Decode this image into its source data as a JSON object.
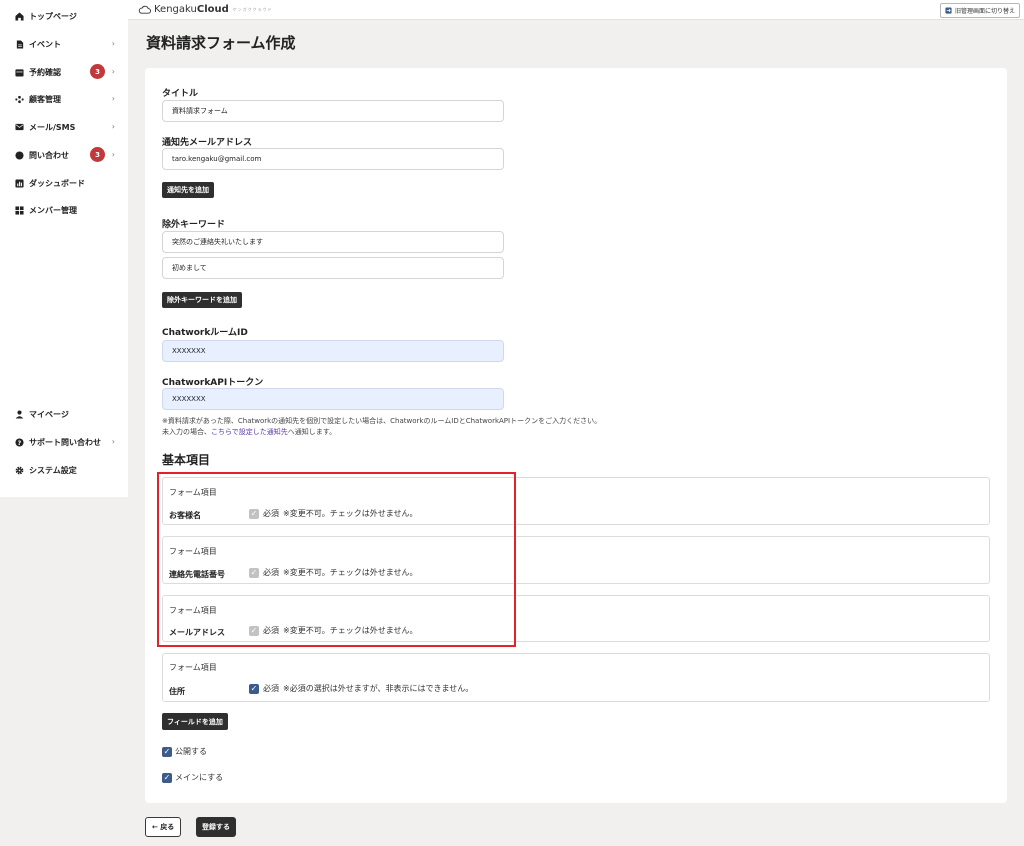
{
  "sidebar": {
    "items": [
      {
        "label": "トップページ",
        "icon": "home-icon"
      },
      {
        "label": "イベント",
        "icon": "document-icon",
        "chevron": "›"
      },
      {
        "label": "予約確認",
        "icon": "calendar-icon",
        "badge": "3",
        "chevron": "›"
      },
      {
        "label": "顧客管理",
        "icon": "users-icon",
        "chevron": "›"
      },
      {
        "label": "メール/SMS",
        "icon": "mail-icon",
        "chevron": "›"
      },
      {
        "label": "問い合わせ",
        "icon": "chat-icon",
        "badge": "3",
        "chevron": "›"
      },
      {
        "label": "ダッシュボード",
        "icon": "chart-icon"
      },
      {
        "label": "メンバー管理",
        "icon": "grid-icon"
      }
    ],
    "bottom_items": [
      {
        "label": "マイページ",
        "icon": "user-icon"
      },
      {
        "label": "サポート問い合わせ",
        "icon": "help-icon",
        "chevron": "›"
      },
      {
        "label": "システム設定",
        "icon": "gear-icon"
      }
    ]
  },
  "header": {
    "logo_plain": "Kengaku",
    "logo_bold": "Cloud",
    "logo_sub": "ケンガククラウド",
    "switch_label": "旧管理画面に切り替え"
  },
  "page": {
    "title": "資料請求フォーム作成"
  },
  "form": {
    "title_label": "タイトル",
    "title_value": "資料請求フォーム",
    "notify_label": "通知先メールアドレス",
    "notify_value": "taro.kengaku@gmail.com",
    "add_notify_button": "通知先を追加",
    "exclude_label": "除外キーワード",
    "exclude_values": [
      "突然のご連絡失礼いたします",
      "初めまして"
    ],
    "add_exclude_button": "除外キーワードを追加",
    "chatwork_room_label": "ChatworkルームID",
    "chatwork_room_value": "XXXXXXX",
    "chatwork_token_label": "ChatworkAPIトークン",
    "chatwork_token_value": "XXXXXXX",
    "note_line1": "※資料請求があった際、Chatworkの通知先を個別で設定したい場合は、ChatworkのルームIDとChatworkAPIトークンをご入力ください。",
    "note_line2_prefix": "未入力の場合、",
    "note_line2_link": "こちらで設定した通知先へ",
    "note_line2_suffix": "通知します。"
  },
  "basic_items": {
    "section_title": "基本項目",
    "items": [
      {
        "type_label": "フォーム項目",
        "name": "お客様名",
        "check_label": "必須",
        "note": "※変更不可。チェックは外せません。"
      },
      {
        "type_label": "フォーム項目",
        "name": "連絡先電話番号",
        "check_label": "必須",
        "note": "※変更不可。チェックは外せません。"
      },
      {
        "type_label": "フォーム項目",
        "name": "メールアドレス",
        "check_label": "必須",
        "note": "※変更不可。チェックは外せません。"
      },
      {
        "type_label": "フォーム項目",
        "name": "住所",
        "check_label": "必須",
        "note": "※必須の選択は外せますが、非表示にはできません。"
      }
    ],
    "add_field_button": "フィールドを追加",
    "publish_label": "公開する",
    "main_label": "メインにする"
  },
  "actions": {
    "back_label": "← 戻る",
    "submit_label": "登録する"
  },
  "colors": {
    "badge": "#c0393b",
    "dark_button": "#2f2f2f",
    "checkbox_checked": "#3d5b8a",
    "highlight_border": "#e2232a",
    "link": "#5b3aa6"
  }
}
